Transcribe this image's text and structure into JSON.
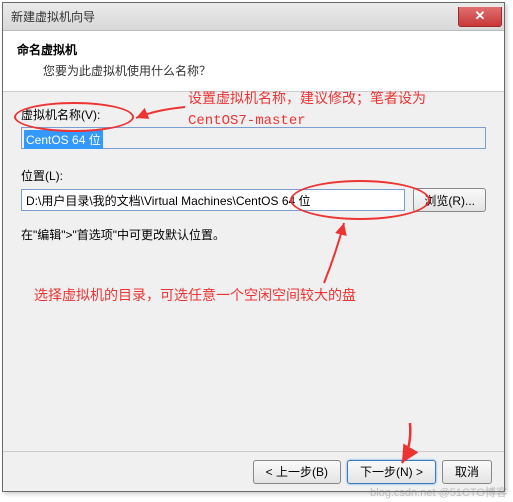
{
  "window": {
    "title": "新建虚拟机向导",
    "close_label": "✕"
  },
  "header": {
    "title": "命名虚拟机",
    "subtitle": "您要为此虚拟机使用什么名称？"
  },
  "fields": {
    "name_label": "虚拟机名称(V):",
    "name_value": "CentOS 64 位",
    "location_label": "位置(L):",
    "location_value": "D:\\用户目录\\我的文档\\Virtual Machines\\CentOS 64 位",
    "browse_label": "浏览(R)..."
  },
  "hint": "在\"编辑\">\"首选项\"中可更改默认位置。",
  "footer": {
    "back": "< 上一步(B)",
    "next": "下一步(N) >",
    "cancel": "取消"
  },
  "annotations": {
    "name_note": "设置虚拟机名称，建议修改；笔者设为\nCentOS7-master",
    "dir_note": "选择虚拟机的目录，可选任意一个空闲空间较大的盘"
  },
  "watermark": "blog.csdn.net @51CTO博客"
}
